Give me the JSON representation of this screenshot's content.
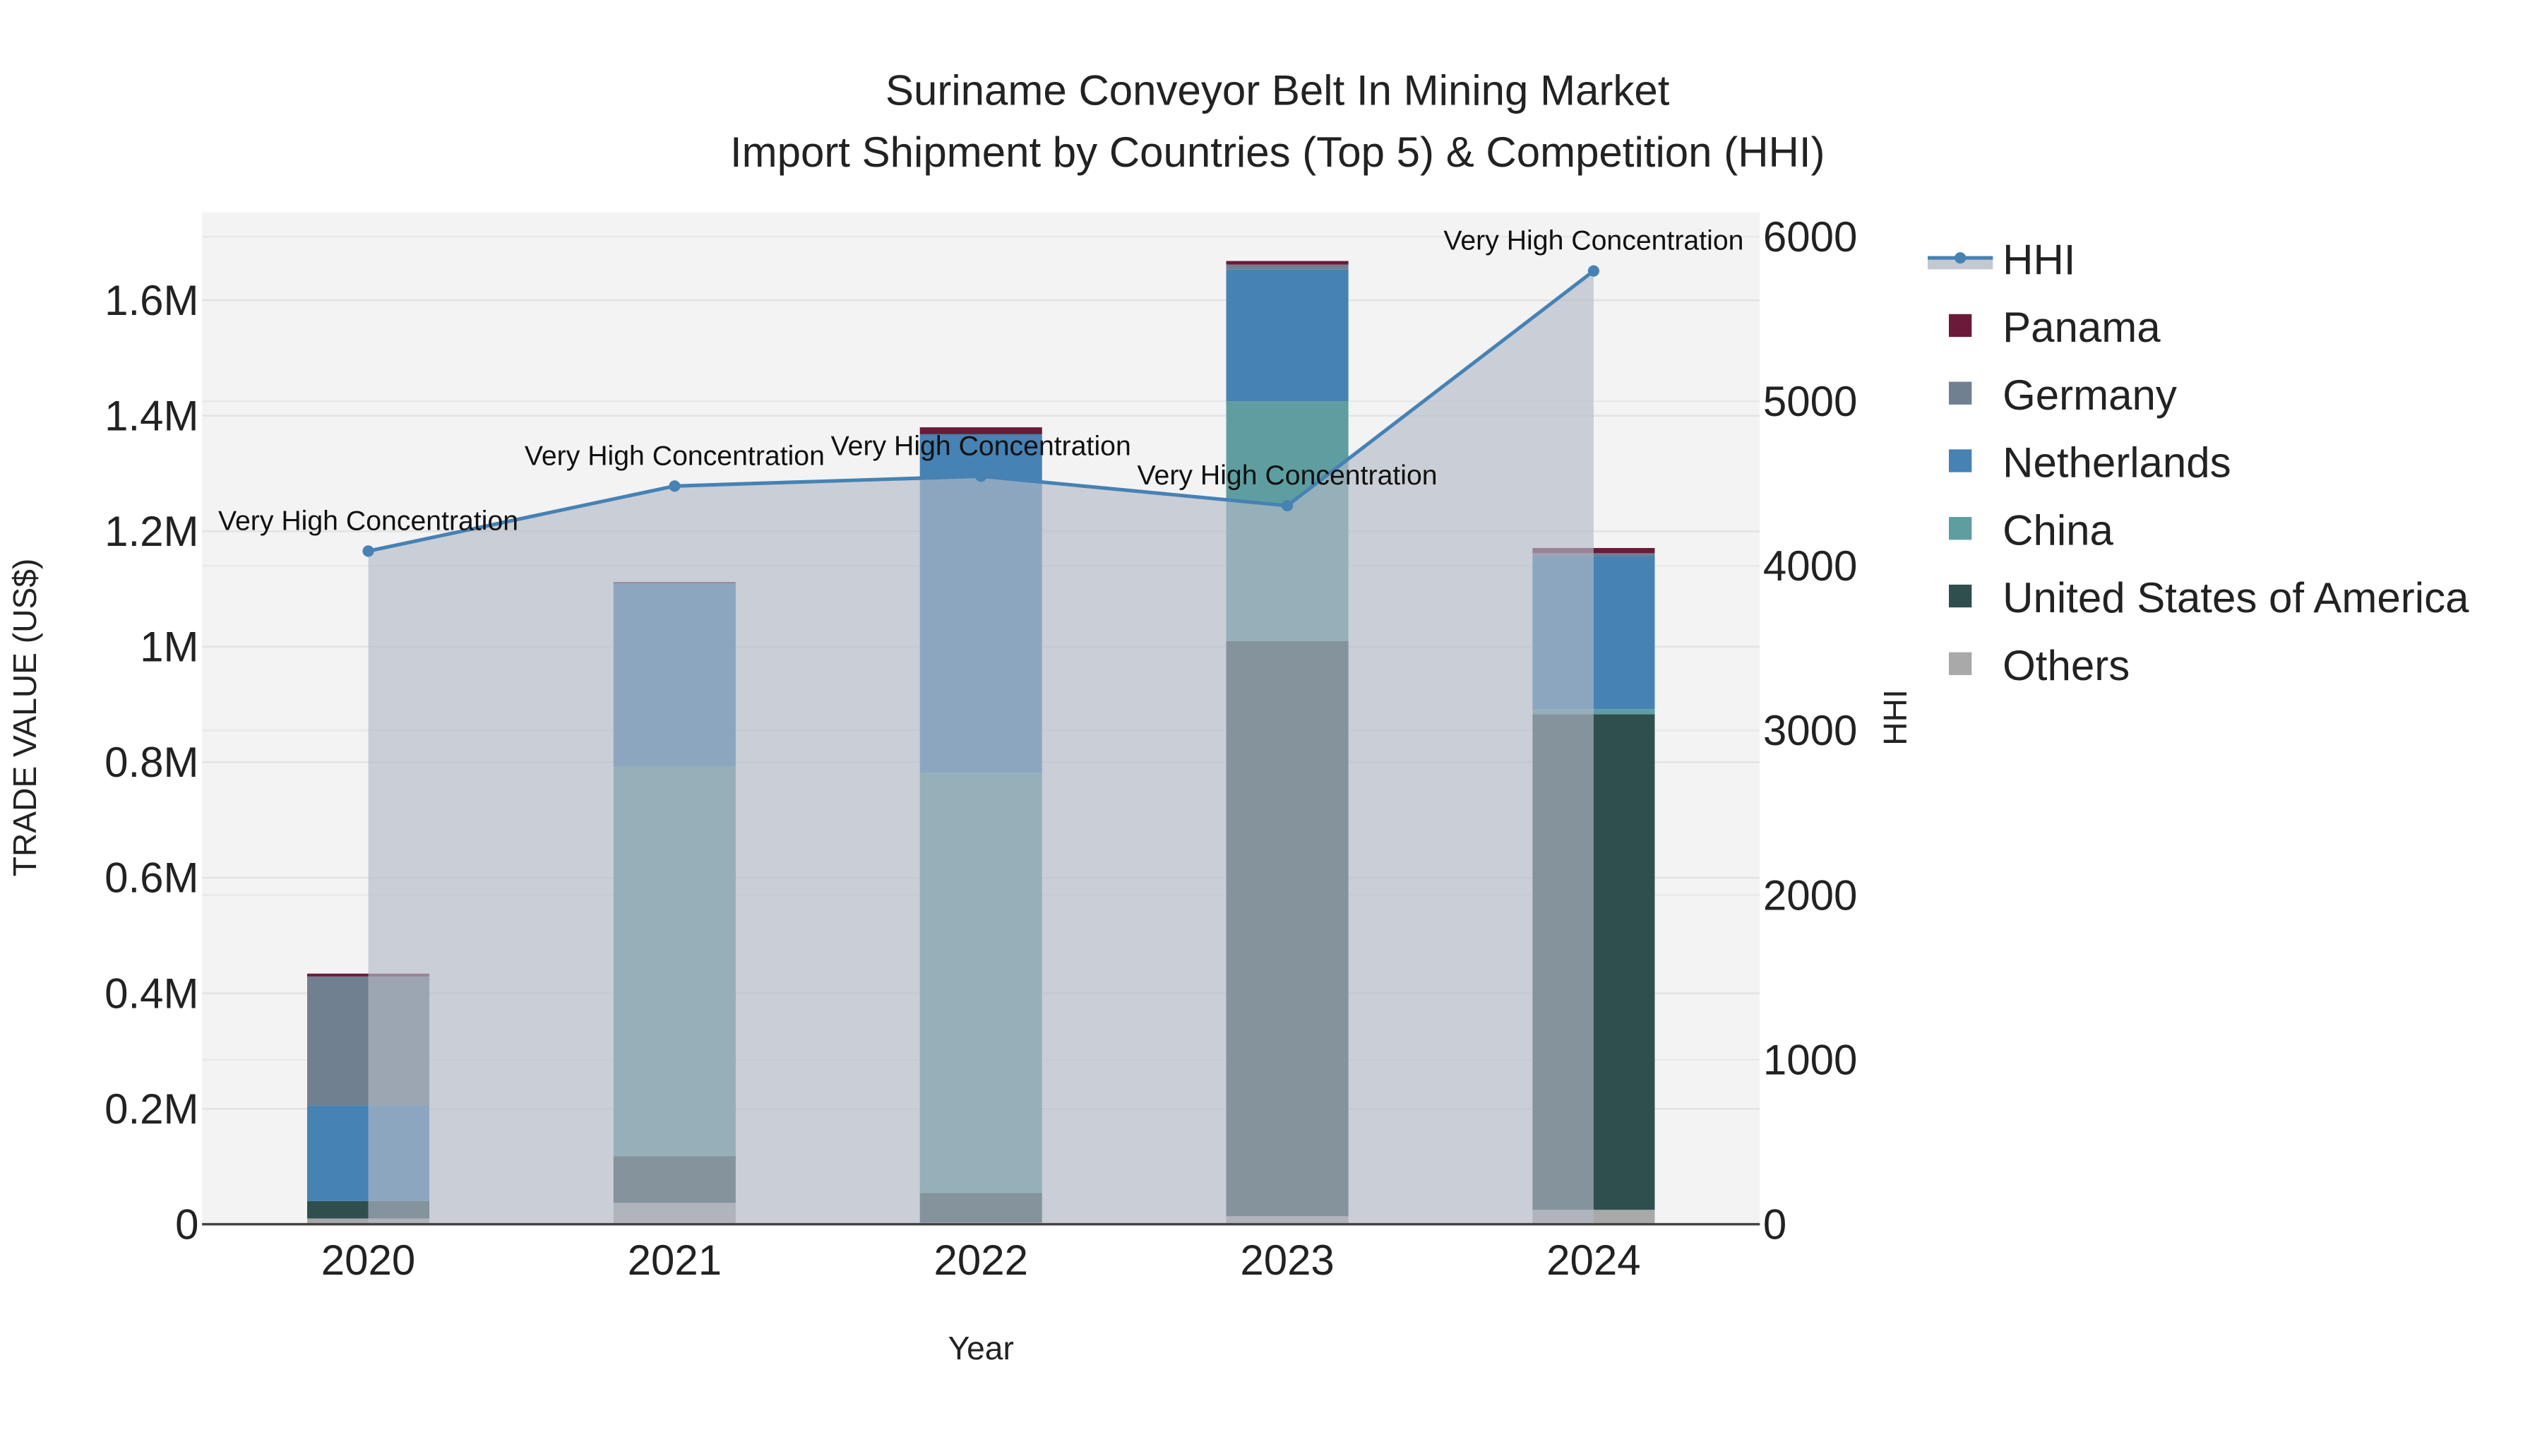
{
  "chart_data": {
    "type": "bar",
    "title": "Suriname Conveyor Belt In Mining Market",
    "subtitle": "Import Shipment by Countries (Top 5) & Competition (HHI)",
    "xlabel": "Year",
    "ylabel": "TRADE VALUE (US$)",
    "y2label": "HHI",
    "categories": [
      "2020",
      "2021",
      "2022",
      "2023",
      "2024"
    ],
    "ylim": [
      0,
      1750000
    ],
    "y2lim": [
      0,
      6150
    ],
    "yticks": [
      0,
      200000,
      400000,
      600000,
      800000,
      1000000,
      1200000,
      1400000,
      1600000
    ],
    "ytick_labels": [
      "0",
      "0.2M",
      "0.4M",
      "0.6M",
      "0.8M",
      "1M",
      "1.2M",
      "1.4M",
      "1.6M"
    ],
    "y2ticks": [
      0,
      1000,
      2000,
      3000,
      4000,
      5000,
      6000
    ],
    "y2tick_labels": [
      "0",
      "1000",
      "2000",
      "3000",
      "4000",
      "5000",
      "6000"
    ],
    "stacked": true,
    "series": [
      {
        "name": "Others",
        "color": "#a9a9a9",
        "values": [
          10000,
          37000,
          3000,
          14000,
          25000
        ]
      },
      {
        "name": "United States of America",
        "color": "#2f4f4f",
        "values": [
          30000,
          81000,
          51000,
          996000,
          858000
        ]
      },
      {
        "name": "China",
        "color": "#5f9ea0",
        "values": [
          0,
          675000,
          728000,
          415000,
          9000
        ]
      },
      {
        "name": "Netherlands",
        "color": "#4682b4",
        "values": [
          166000,
          316000,
          586000,
          228000,
          265000
        ]
      },
      {
        "name": "Germany",
        "color": "#708090",
        "values": [
          223000,
          2000,
          0,
          9000,
          5000
        ]
      },
      {
        "name": "Panama",
        "color": "#6b1a3a",
        "values": [
          5000,
          1000,
          12000,
          6000,
          9000
        ]
      }
    ],
    "hhi": {
      "name": "HHI",
      "color": "#4682b4",
      "values": [
        4090,
        4485,
        4545,
        4366,
        5792
      ],
      "annotations": [
        "Very High Concentration",
        "Very High Concentration",
        "Very High Concentration",
        "Very High Concentration",
        "Very High Concentration"
      ]
    },
    "legend": {
      "placement": "right",
      "entries": [
        "HHI",
        "Panama",
        "Germany",
        "Netherlands",
        "China",
        "United States of America",
        "Others"
      ]
    },
    "grid": true
  }
}
